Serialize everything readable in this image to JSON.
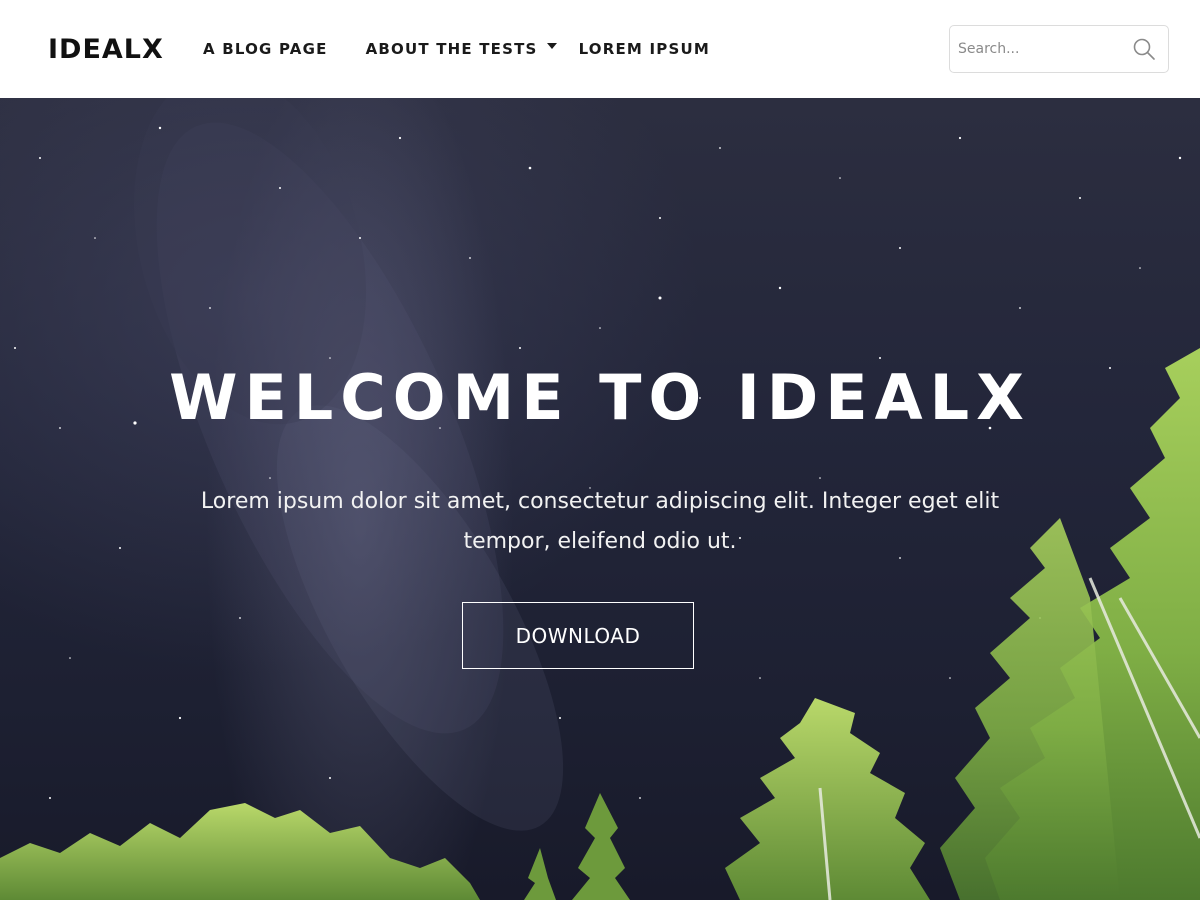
{
  "header": {
    "brand": "IDEALX",
    "nav": [
      {
        "label": "A BLOG PAGE"
      },
      {
        "label": "ABOUT THE TESTS",
        "dropdown": true
      },
      {
        "label": "LOREM IPSUM"
      }
    ],
    "search": {
      "placeholder": "Search...",
      "value": "",
      "icon": "search-icon"
    }
  },
  "hero": {
    "title": "WELCOME TO IDEALX",
    "subtitle": "Lorem ipsum dolor sit amet, consectetur adipiscing elit. Integer eget elit tempor, eleifend odio ut.",
    "button_label": "DOWNLOAD",
    "background": "starry night sky with milky way and tree tops"
  },
  "colors": {
    "header_bg": "#ffffff",
    "nav_text": "#1a1a1a",
    "hero_text": "#ffffff",
    "sky": "#23263a",
    "foliage": "#8fbf4a"
  }
}
